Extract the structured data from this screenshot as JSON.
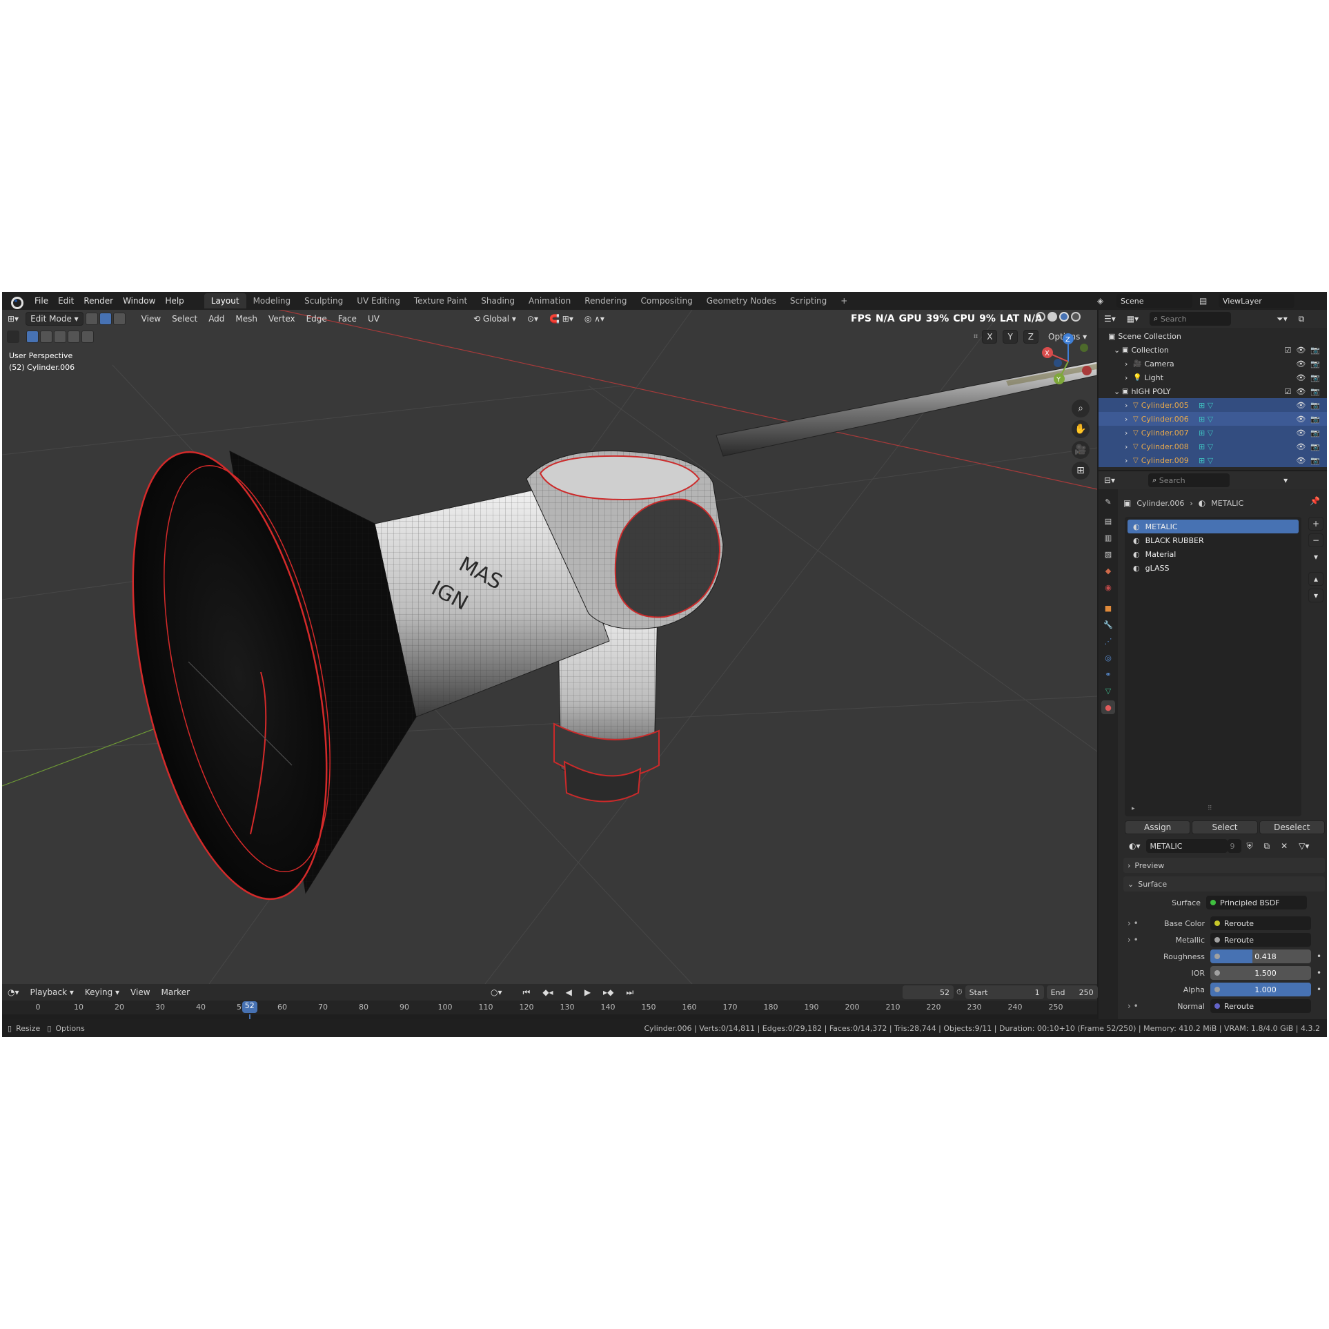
{
  "menu": [
    "File",
    "Edit",
    "Render",
    "Window",
    "Help"
  ],
  "workspaces": [
    "Layout",
    "Modeling",
    "Sculpting",
    "UV Editing",
    "Texture Paint",
    "Shading",
    "Animation",
    "Rendering",
    "Compositing",
    "Geometry Nodes",
    "Scripting"
  ],
  "active_workspace": "Layout",
  "add_workspace": "+",
  "scene": {
    "label": "Scene",
    "viewlayer": "ViewLayer"
  },
  "viewport": {
    "mode": "Edit Mode",
    "menus": [
      "View",
      "Select",
      "Add",
      "Mesh",
      "Vertex",
      "Edge",
      "Face",
      "UV"
    ],
    "orientation": "Global",
    "perspective": "User Perspective",
    "object_info": "(52) Cylinder.006",
    "options": "Options",
    "axes": [
      "X",
      "Y",
      "Z"
    ],
    "hud": {
      "fps_label": "FPS",
      "fps": "N/A",
      "gpu_label": "GPU",
      "gpu": "39%",
      "cpu_label": "CPU",
      "cpu": "9%",
      "lat_label": "LAT",
      "lat": "N/A"
    },
    "gizmo": {
      "x": "X",
      "y": "Y",
      "z": "Z"
    },
    "model_label_1": "MAS",
    "model_label_2": "IGN",
    "colors": {
      "bg": "#393939",
      "selected_edge": "#d42a2a",
      "x_axis": "#d94c4c",
      "y_axis": "#7ea83a",
      "z_axis": "#3f7fd6"
    }
  },
  "outliner": {
    "search_placeholder": "Search",
    "scene_collection": "Scene Collection",
    "rows": [
      {
        "name": "Collection",
        "type": "collection"
      },
      {
        "name": "Camera",
        "type": "camera"
      },
      {
        "name": "Light",
        "type": "light"
      },
      {
        "name": "hIGH POLY",
        "type": "collection"
      },
      {
        "name": "Cylinder.005",
        "type": "mesh",
        "selected": true
      },
      {
        "name": "Cylinder.006",
        "type": "mesh",
        "selected": true,
        "active": true
      },
      {
        "name": "Cylinder.007",
        "type": "mesh",
        "selected": true
      },
      {
        "name": "Cylinder.008",
        "type": "mesh",
        "selected": true
      },
      {
        "name": "Cylinder.009",
        "type": "mesh",
        "selected": true
      }
    ]
  },
  "properties": {
    "search_placeholder": "Search",
    "breadcrumb_object": "Cylinder.006",
    "breadcrumb_material": "METALIC",
    "material_slots": [
      "METALIC",
      "BLACK RUBBER",
      "Material",
      "gLASS"
    ],
    "active_slot": "METALIC",
    "assign": "Assign",
    "select": "Select",
    "deselect": "Deselect",
    "material_name": "METALIC",
    "material_users": "9",
    "preview_label": "Preview",
    "surface_section": "Surface",
    "surface_label": "Surface",
    "surface_value": "Principled BSDF",
    "inputs": [
      {
        "label": "Base Color",
        "value": "Reroute",
        "type": "link",
        "color": "#c7c729"
      },
      {
        "label": "Metallic",
        "value": "Reroute",
        "type": "link",
        "color": "#a1a1a1"
      },
      {
        "label": "Roughness",
        "value": "0.418",
        "type": "slider",
        "fraction": 0.418
      },
      {
        "label": "IOR",
        "value": "1.500",
        "type": "number"
      },
      {
        "label": "Alpha",
        "value": "1.000",
        "type": "slider",
        "fraction": 1.0
      },
      {
        "label": "Normal",
        "value": "Reroute",
        "type": "link",
        "color": "#6363c7"
      }
    ]
  },
  "timeline": {
    "menus": [
      "Playback",
      "Keying",
      "View",
      "Marker"
    ],
    "current_frame": "52",
    "start_label": "Start",
    "start": "1",
    "end_label": "End",
    "end": "250",
    "ticks": [
      "0",
      "10",
      "20",
      "30",
      "40",
      "50",
      "60",
      "70",
      "80",
      "90",
      "100",
      "110",
      "120",
      "130",
      "140",
      "150",
      "160",
      "170",
      "180",
      "190",
      "200",
      "210",
      "220",
      "230",
      "240",
      "250"
    ],
    "playhead": 52
  },
  "status": {
    "left": [
      "Resize",
      "Options"
    ],
    "right": "Cylinder.006 | Verts:0/14,811 | Edges:0/29,182 | Faces:0/14,372 | Tris:28,744 | Objects:9/11 | Duration: 00:10+10 (Frame 52/250) | Memory: 410.2 MiB | VRAM: 1.8/4.0 GiB | 4.3.2"
  }
}
